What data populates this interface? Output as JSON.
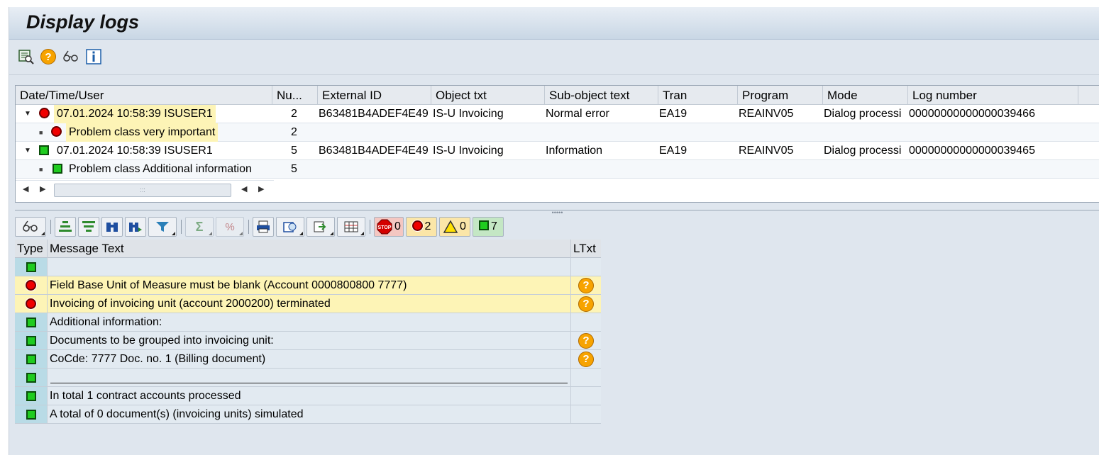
{
  "window": {
    "title": "Display logs"
  },
  "app_toolbar": {
    "icons": [
      "detail-list-icon",
      "help-icon",
      "glasses-icon",
      "info-icon"
    ]
  },
  "log_tree": {
    "columns": [
      "Date/Time/User",
      "Nu...",
      "External ID",
      "Object txt",
      "Sub-object text",
      "Tran",
      "Program",
      "Mode",
      "Log number"
    ],
    "rows": [
      {
        "level": 0,
        "status": "error",
        "expanded": true,
        "datetime_user": "07.01.2024  10:58:39  ISUSER1",
        "number": "2",
        "external_id": "B63481B4ADEF4E49",
        "object_txt": "IS-U Invoicing",
        "subobject_txt": "Normal error",
        "tran": "EA19",
        "program": "REAINV05",
        "mode": "Dialog processi",
        "log_number": "00000000000000039466"
      },
      {
        "level": 1,
        "status": "error",
        "label": "Problem class very important",
        "number": "2"
      },
      {
        "level": 0,
        "status": "success",
        "expanded": true,
        "datetime_user": "07.01.2024  10:58:39  ISUSER1",
        "number": "5",
        "external_id": "B63481B4ADEF4E49",
        "object_txt": "IS-U Invoicing",
        "subobject_txt": "Information",
        "tran": "EA19",
        "program": "REAINV05",
        "mode": "Dialog processi",
        "log_number": "00000000000000039465"
      },
      {
        "level": 1,
        "status": "success",
        "label": "Problem class Additional information",
        "number": "5"
      }
    ]
  },
  "message_toolbar": {
    "counts": {
      "stop": "0",
      "error": "2",
      "warning": "0",
      "success": "7"
    }
  },
  "messages": {
    "columns": [
      "Type",
      "Message Text",
      "LTxt"
    ],
    "rows": [
      {
        "type": "success",
        "text": "",
        "ltxt": false
      },
      {
        "type": "error",
        "text": "Field Base Unit of Measure must be blank (Account 0000800800 7777)",
        "ltxt": true
      },
      {
        "type": "error",
        "text": "Invoicing of invoicing unit (account 2000200) terminated",
        "ltxt": true
      },
      {
        "type": "success",
        "text": "Additional information:",
        "ltxt": false
      },
      {
        "type": "success",
        "text": "Documents to be grouped into invoicing unit:",
        "ltxt": true
      },
      {
        "type": "success",
        "text": "CoCde: 7777 Doc. no. 1 (Billing document)",
        "ltxt": true
      },
      {
        "type": "success",
        "text": "",
        "ltxt": false,
        "separator": true
      },
      {
        "type": "success",
        "text": "In total 1 contract accounts processed",
        "ltxt": false
      },
      {
        "type": "success",
        "text": "A total of 0 document(s) (invoicing units) simulated",
        "ltxt": false
      }
    ]
  },
  "colors": {
    "error_row": "#fdf4b6",
    "type_cell": "#b9dbe6",
    "window_bg": "#dfe6ee"
  }
}
